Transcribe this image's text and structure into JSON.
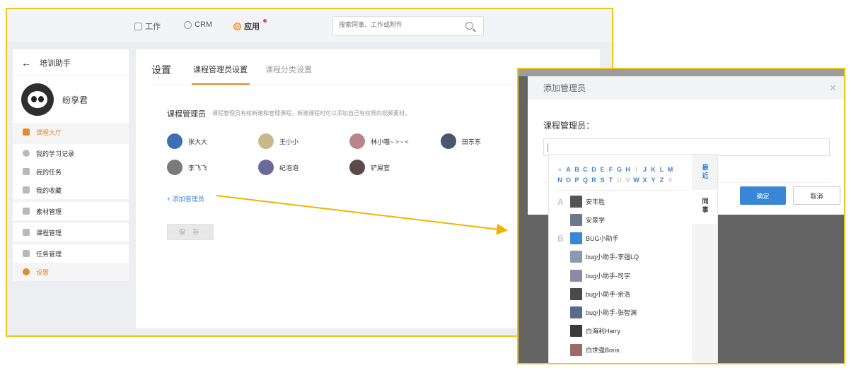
{
  "topnav": {
    "items": [
      {
        "label": "工作"
      },
      {
        "label": "CRM"
      },
      {
        "label": "应用"
      }
    ],
    "search_placeholder": "搜索同事、工作或附件"
  },
  "sidebar": {
    "back_title": "培训助手",
    "user_name": "纷享君",
    "items": [
      {
        "label": "课程大厅"
      },
      {
        "label": "我的学习记录"
      },
      {
        "label": "我的任务"
      },
      {
        "label": "我的收藏"
      },
      {
        "label": "素材管理"
      },
      {
        "label": "课程管理"
      },
      {
        "label": "任务管理"
      },
      {
        "label": "设置"
      }
    ]
  },
  "content": {
    "title": "设置",
    "tabs": [
      {
        "label": "课程管理员设置"
      },
      {
        "label": "课程分类设置"
      }
    ],
    "section_label": "课程管理员",
    "section_desc": "课程管理员有权新建和管理课程，新建课程时可以添加自己有权限的视频素材。",
    "admins": [
      {
        "name": "张大大",
        "color": "#3d6fb5"
      },
      {
        "name": "王小小",
        "color": "#c8b98a"
      },
      {
        "name": "林小喵~ > ᵕ <",
        "color": "#b8868a"
      },
      {
        "name": "田东东",
        "color": "#4a5570"
      },
      {
        "name": "李飞飞",
        "color": "#7a7a7a"
      },
      {
        "name": "纪泡泡",
        "color": "#6a6a9a"
      },
      {
        "name": "铲屎官",
        "color": "#5a4a4a"
      }
    ],
    "add_link": "+ 添加管理员",
    "save_label": "保 存"
  },
  "dialog": {
    "title": "添加管理员",
    "field_label": "课程管理员：",
    "ok_label": "确定",
    "cancel_label": "取消"
  },
  "picker": {
    "letters_row1": [
      "★",
      "A",
      "B",
      "C",
      "D",
      "E",
      "F",
      "G",
      "H",
      "I",
      "J",
      "K",
      "L",
      "M"
    ],
    "letters_row2": [
      "N",
      "O",
      "P",
      "Q",
      "R",
      "S",
      "T",
      "U",
      "V",
      "W",
      "X",
      "Y",
      "Z",
      "#"
    ],
    "side_tabs": [
      {
        "label": "最近"
      },
      {
        "label": "同事"
      }
    ],
    "groups": [
      {
        "letter": "A",
        "people": [
          {
            "name": "安丰胜",
            "color": "#555555"
          },
          {
            "name": "安景学",
            "color": "#6a7a8a"
          }
        ]
      },
      {
        "letter": "B",
        "people": [
          {
            "name": "BUG小助手",
            "color": "#3a86d6"
          },
          {
            "name": "bug小助手-李强LQ",
            "color": "#8a9aaa"
          },
          {
            "name": "bug小助手-司宇",
            "color": "#8a8aa5"
          },
          {
            "name": "bug小助手-余浩",
            "color": "#4a4a4a"
          },
          {
            "name": "bug小助手-张智渊",
            "color": "#5a6a8a"
          },
          {
            "name": "白海利Harry",
            "color": "#3a3a3a"
          },
          {
            "name": "白世强Boris",
            "color": "#9a6a6a"
          }
        ]
      }
    ]
  }
}
